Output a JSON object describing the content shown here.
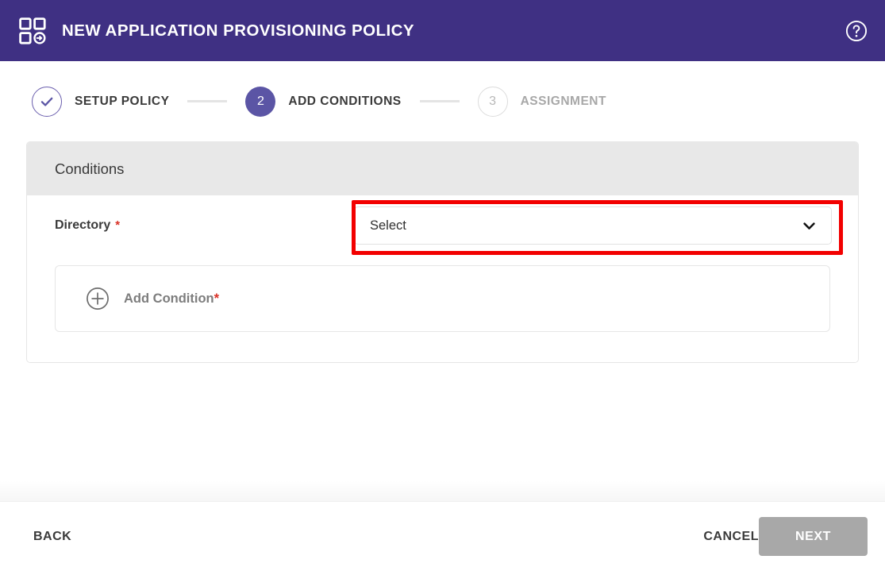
{
  "header": {
    "title": "NEW APPLICATION PROVISIONING POLICY",
    "app_icon": "app-grid-provisioning-icon",
    "help_icon": "help-circle-icon",
    "background_color": "#3f3083"
  },
  "stepper": {
    "steps": [
      {
        "number": "1",
        "label": "SETUP POLICY",
        "state": "completed",
        "marker": "check-icon"
      },
      {
        "number": "2",
        "label": "ADD CONDITIONS",
        "state": "active",
        "marker": "2"
      },
      {
        "number": "3",
        "label": "ASSIGNMENT",
        "state": "upcoming",
        "marker": "3"
      }
    ],
    "active_color": "#5b55a5",
    "completed_border_color": "#6b5fae",
    "connector_color": "#e4e4e4"
  },
  "card": {
    "title": "Conditions",
    "header_background": "#e8e8e8",
    "fields": [
      {
        "label": "Directory",
        "required_marker": "*",
        "control": "select",
        "value": "Select",
        "placeholder": "Select",
        "chevron_icon": "chevron-down-icon",
        "highlighted": true,
        "highlight_color": "#f20000"
      }
    ],
    "add_condition": {
      "icon": "plus-circle-icon",
      "label": "Add Condition",
      "required_marker": "*"
    }
  },
  "footer": {
    "back_label": "BACK",
    "cancel_label": "CANCEL",
    "next_label": "NEXT",
    "next_disabled": true,
    "next_disabled_color": "#a8a8a8"
  },
  "colors": {
    "required_asterisk": "#d93025",
    "text_primary": "#3a3a3a",
    "text_muted": "#a8a8a8",
    "page_background": "#ffffff"
  }
}
